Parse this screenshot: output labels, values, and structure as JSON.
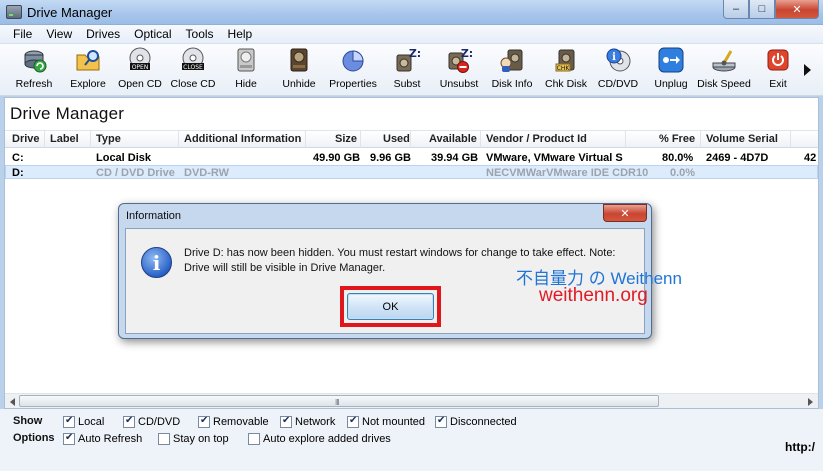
{
  "window": {
    "title": "Drive Manager",
    "min": "–",
    "max": "□",
    "close": "✕"
  },
  "menu": [
    "File",
    "View",
    "Drives",
    "Optical",
    "Tools",
    "Help"
  ],
  "toolbar": [
    {
      "label": "Refresh",
      "icon": "refresh-icon"
    },
    {
      "label": "Explore",
      "icon": "explore-icon"
    },
    {
      "label": "Open CD",
      "icon": "open-cd-icon",
      "badge": "OPEN"
    },
    {
      "label": "Close CD",
      "icon": "close-cd-icon",
      "badge": "CLOSE"
    },
    {
      "label": "Hide",
      "icon": "hide-icon"
    },
    {
      "label": "Unhide",
      "icon": "unhide-icon"
    },
    {
      "label": "Properties",
      "icon": "properties-icon"
    },
    {
      "label": "Subst",
      "icon": "subst-icon"
    },
    {
      "label": "Unsubst",
      "icon": "unsubst-icon"
    },
    {
      "label": "Disk Info",
      "icon": "disk-info-icon"
    },
    {
      "label": "Chk Disk",
      "icon": "chk-disk-icon"
    },
    {
      "label": "CD/DVD",
      "icon": "cd-dvd-icon"
    },
    {
      "label": "Unplug",
      "icon": "unplug-icon"
    },
    {
      "label": "Disk Speed",
      "icon": "disk-speed-icon"
    },
    {
      "label": "Exit",
      "icon": "exit-icon"
    }
  ],
  "main": {
    "title": "Drive Manager",
    "columns": [
      "Drive",
      "Label",
      "Type",
      "Additional Information",
      "Size",
      "Used",
      "Available",
      "Vendor / Product Id",
      "% Free",
      "Volume Serial"
    ],
    "rows": [
      {
        "drive": "C:",
        "label": "",
        "type": "Local Disk",
        "info": "",
        "size": "49.90 GB",
        "used": "9.96 GB",
        "available": "39.94 GB",
        "vendor": "VMware, VMware Virtual S",
        "free": "80.0%",
        "serial": "2469 - 4D7D",
        "extra": "42"
      },
      {
        "drive": "D:",
        "label": "",
        "type": "CD / DVD Drive",
        "info": "DVD-RW",
        "size": "",
        "used": "",
        "available": "",
        "vendor": "NECVMWarVMware IDE CDR10",
        "free": "0.0%",
        "serial": "",
        "extra": ""
      }
    ],
    "scroll_grip": "III"
  },
  "options": {
    "show_label": "Show",
    "options_label": "Options",
    "show": [
      {
        "label": "Local",
        "checked": true
      },
      {
        "label": "CD/DVD",
        "checked": true
      },
      {
        "label": "Removable",
        "checked": true
      },
      {
        "label": "Network",
        "checked": true
      },
      {
        "label": "Not mounted",
        "checked": true
      },
      {
        "label": "Disconnected",
        "checked": true
      }
    ],
    "opts": [
      {
        "label": "Auto Refresh",
        "checked": true
      },
      {
        "label": "Stay on top",
        "checked": false
      },
      {
        "label": "Auto explore added drives",
        "checked": false
      }
    ],
    "link": "http:/"
  },
  "dialog": {
    "title": "Information",
    "close": "✕",
    "message": "Drive D: has now been hidden. You must restart windows for change to take effect. Note: Drive will still be visible in Drive Manager.",
    "ok": "OK",
    "icon_glyph": "i"
  },
  "watermark": {
    "line1": "不自量力 の Weithenn",
    "line2": "weithenn.org"
  },
  "colors": {
    "highlight": "#e0161d",
    "accent": "#2a62c8"
  }
}
